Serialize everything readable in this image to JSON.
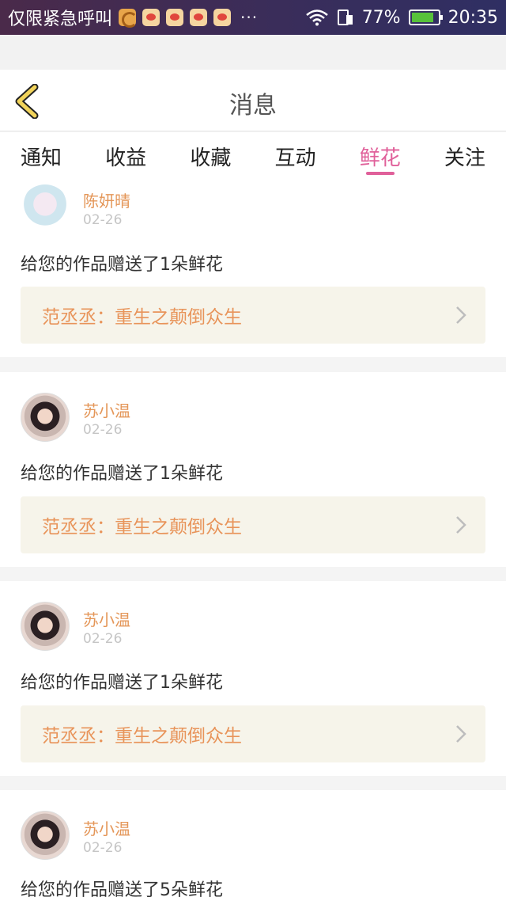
{
  "status_bar": {
    "carrier_text": "仅限紧急呼叫",
    "overflow": "···",
    "battery_percent": "77%",
    "time": "20:35",
    "icons": [
      "uc-browser-icon",
      "weibo-icon",
      "weibo-icon",
      "weibo-icon",
      "weibo-icon",
      "wifi-icon",
      "sim-icon",
      "battery-icon"
    ]
  },
  "header": {
    "title": "消息",
    "back_icon": "chevron-left-icon"
  },
  "tabs": [
    "通知",
    "收益",
    "收藏",
    "互动",
    "鲜花",
    "关注"
  ],
  "active_tab": "鲜花",
  "accent_color": "#e0609a",
  "name_color": "#e49658",
  "messages": [
    {
      "name": "陈妍晴",
      "date": "02-26",
      "text": "给您的作品赠送了1朵鲜花",
      "work": "范丞丞：重生之颠倒众生",
      "avatar": "anime-girl-avatar"
    },
    {
      "name": "苏小温",
      "date": "02-26",
      "text": "给您的作品赠送了1朵鲜花",
      "work": "范丞丞：重生之颠倒众生",
      "avatar": "woman-photo-avatar"
    },
    {
      "name": "苏小温",
      "date": "02-26",
      "text": "给您的作品赠送了1朵鲜花",
      "work": "范丞丞：重生之颠倒众生",
      "avatar": "woman-photo-avatar"
    },
    {
      "name": "苏小温",
      "date": "02-26",
      "text": "给您的作品赠送了5朵鲜花",
      "avatar": "woman-photo-avatar"
    }
  ]
}
